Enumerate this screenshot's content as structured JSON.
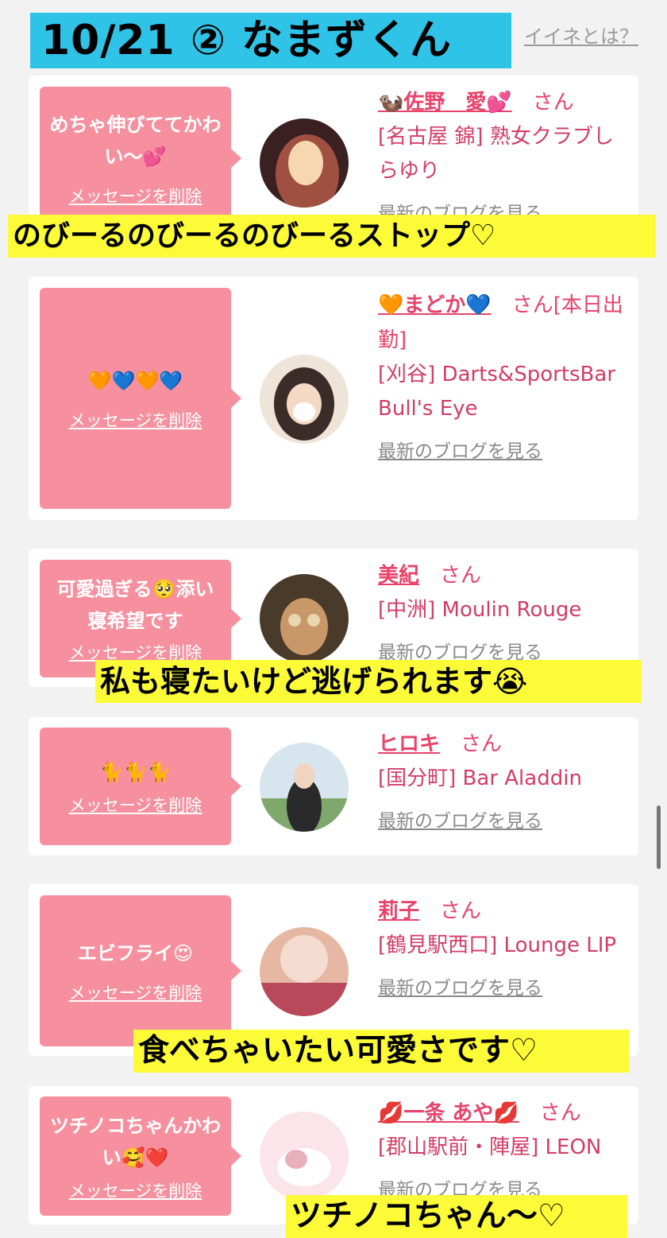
{
  "header": {
    "title": "10/21 ② なまずくん",
    "help_link": "イイネとは？"
  },
  "delete_label": "メッセージを削除",
  "blog_label": "最新のブログを見る",
  "cards": [
    {
      "message": "めちゃ伸びててかわい〜💕",
      "name": "🦦佐野　愛💕",
      "suffix": "さん",
      "shop": "[名古屋 錦] 熟女クラブしらゆり",
      "avatar_colors": [
        "#f7d7b0",
        "#a05040",
        "#3a2020"
      ]
    },
    {
      "message": "🧡💙🧡💙",
      "name": "🧡まどか💙",
      "suffix": "さん[本日出勤]",
      "shop": "[刈谷] Darts&SportsBar Bull's Eye",
      "avatar_colors": [
        "#efe4d8",
        "#3a2c28",
        "#fdfdfd"
      ]
    },
    {
      "message": "可愛過ぎる🥺添い寝希望です",
      "name": "美紀",
      "suffix": "さん",
      "shop": "[中洲] Moulin Rouge",
      "avatar_colors": [
        "#4a3a2a",
        "#c89868",
        "#e9d6b0"
      ]
    },
    {
      "message": "🐈🐈🐈",
      "name": "ヒロキ",
      "suffix": "さん",
      "shop": "[国分町] Bar Aladdin",
      "avatar_colors": [
        "#d7e6ee",
        "#2a2a2a",
        "#7ea86c"
      ]
    },
    {
      "message": "エビフライ😍",
      "name": "莉子",
      "suffix": "さん",
      "shop": "[鶴見駅西口] Lounge LIP",
      "avatar_colors": [
        "#f5dcd0",
        "#b8485a",
        "#e6b8a4"
      ]
    },
    {
      "message": "ツチノコちゃんかわい🥰❤️",
      "name": "💋一条 あや💋",
      "suffix": "さん",
      "shop": "[郡山駅前・陣屋] LEON",
      "avatar_colors": [
        "#fbe4ea",
        "#e8b0bd",
        "#ffffff"
      ]
    }
  ],
  "captions": [
    "のびーるのびーるのびーるストップ♡",
    "私も寝たいけど逃げられます😭",
    "食べちゃいたい可愛さです♡",
    "ツチノコちゃん〜♡"
  ],
  "colors": {
    "bubble": "#f6909f",
    "name": "#e8436b",
    "banner": "#2fc3e8",
    "caption": "#fdfb37"
  }
}
